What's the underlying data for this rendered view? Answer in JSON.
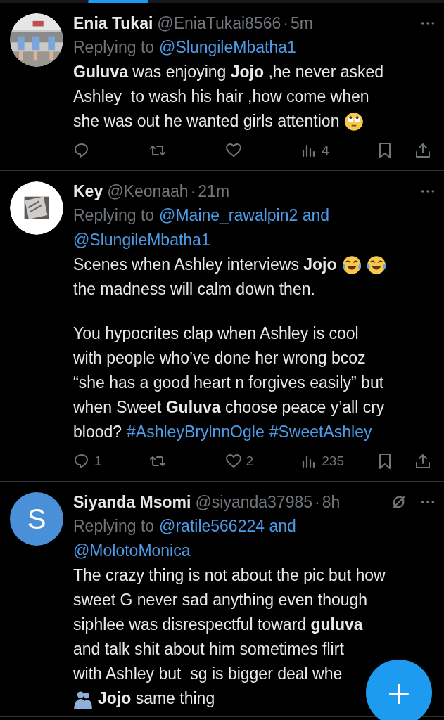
{
  "tweets": [
    {
      "name": "Enia Tukai",
      "handle": "@EniaTukai8566",
      "separator": "·",
      "time": "5m",
      "avatar": {
        "kind": "picture"
      },
      "replying": {
        "label": "Replying to",
        "lines": [
          "@SlungileMbatha1"
        ]
      },
      "paragraphs": [
        [
          {
            "text": "**Guluva** was enjoying **Jojo** ,he never asked"
          },
          {
            "text": "Ashley  to wash his hair ,how come when"
          },
          {
            "text": "she was out he wanted girls attention",
            "after": [
              {
                "kind": "eye-roll"
              }
            ]
          }
        ]
      ],
      "actions": {
        "views": "4"
      }
    },
    {
      "name": "Key",
      "handle": "@Keonaah",
      "separator": "·",
      "time": "21m",
      "avatar": {
        "kind": "framed-picture"
      },
      "replying": {
        "label": "Replying to",
        "lines": [
          "@Maine_rawalpin2 and",
          "@SlungileMbatha1"
        ]
      },
      "paragraphs": [
        [
          {
            "text": "Scenes when Ashley interviews **Jojo**",
            "after": [
              {
                "kind": "laugh"
              },
              {
                "kind": "laugh"
              }
            ]
          },
          {
            "text": "the madness will calm down then."
          }
        ],
        [
          {
            "text": "You hypocrites clap when Ashley is cool"
          },
          {
            "text": "with people who’ve done her wrong bcoz"
          },
          {
            "text": "“she has a good heart n forgives easily” but"
          },
          {
            "text": "when Sweet **Guluva** choose peace y’all cry"
          },
          {
            "text": "blood?",
            "tags": [
              "#AshleyBrylnnOgle",
              "#SweetAshley"
            ]
          }
        ]
      ],
      "actions": {
        "replies": "1",
        "likes": "2",
        "views": "235"
      }
    },
    {
      "name": "Siyanda Msomi",
      "handle": "@siyanda37985",
      "separator": "·",
      "time": "8h",
      "muted": true,
      "avatar": {
        "kind": "letter",
        "letter": "S"
      },
      "replying": {
        "label": "Replying to",
        "lines": [
          "@ratile566224 and",
          "@MolotoMonica"
        ]
      },
      "paragraphs": [
        [
          {
            "text": "The crazy thing is not about the pic but how"
          },
          {
            "text": "sweet G never sad anything even though"
          },
          {
            "text": "siphlee was disrespectful toward **guluva**"
          },
          {
            "text": "and talk shit about him sometimes flirt"
          },
          {
            "text": "with Ashley but  sg is bigger deal whe"
          },
          {
            "text": "**Jojo** same thing",
            "before": [
              {
                "kind": "hug"
              }
            ]
          }
        ]
      ]
    }
  ],
  "fab": {
    "label": "+"
  }
}
